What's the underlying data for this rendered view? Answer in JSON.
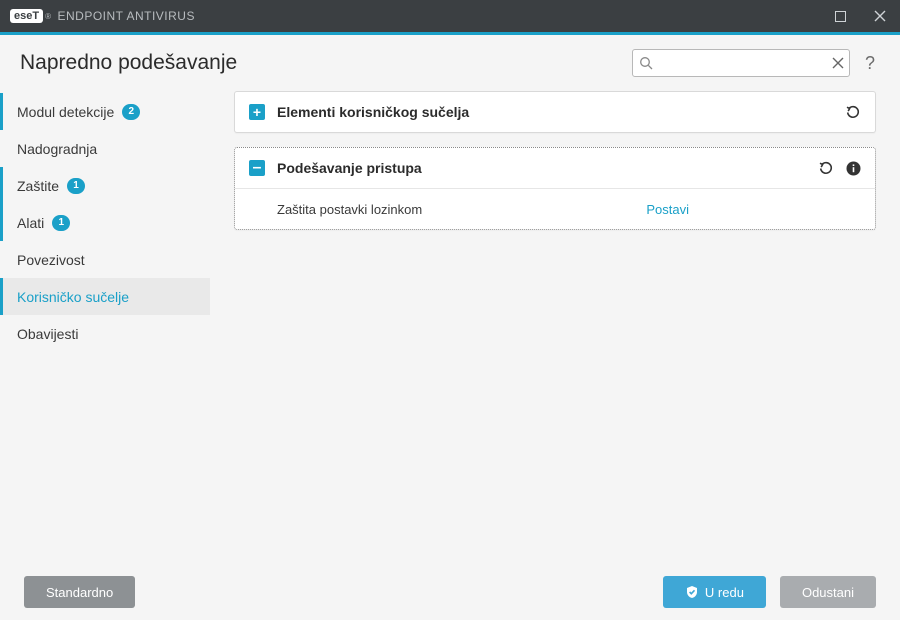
{
  "app": {
    "brand_mark": "eseT",
    "product_name": "ENDPOINT ANTIVIRUS"
  },
  "header": {
    "title": "Napredno podešavanje",
    "search_placeholder": ""
  },
  "sidebar": {
    "items": [
      {
        "label": "Modul detekcije",
        "badge": "2",
        "marked": true
      },
      {
        "label": "Nadogradnja"
      },
      {
        "label": "Zaštite",
        "badge": "1",
        "marked": true
      },
      {
        "label": "Alati",
        "badge": "1",
        "marked": true
      },
      {
        "label": "Povezivost"
      },
      {
        "label": "Korisničko sučelje",
        "active": true
      },
      {
        "label": "Obavijesti"
      }
    ]
  },
  "panels": {
    "ui_elements": {
      "title": "Elementi korisničkog sučelja"
    },
    "access_setup": {
      "title": "Podešavanje pristupa",
      "setting_label": "Zaštita postavki lozinkom",
      "setting_value": "Postavi"
    }
  },
  "footer": {
    "default": "Standardno",
    "ok": "U redu",
    "cancel": "Odustani"
  }
}
